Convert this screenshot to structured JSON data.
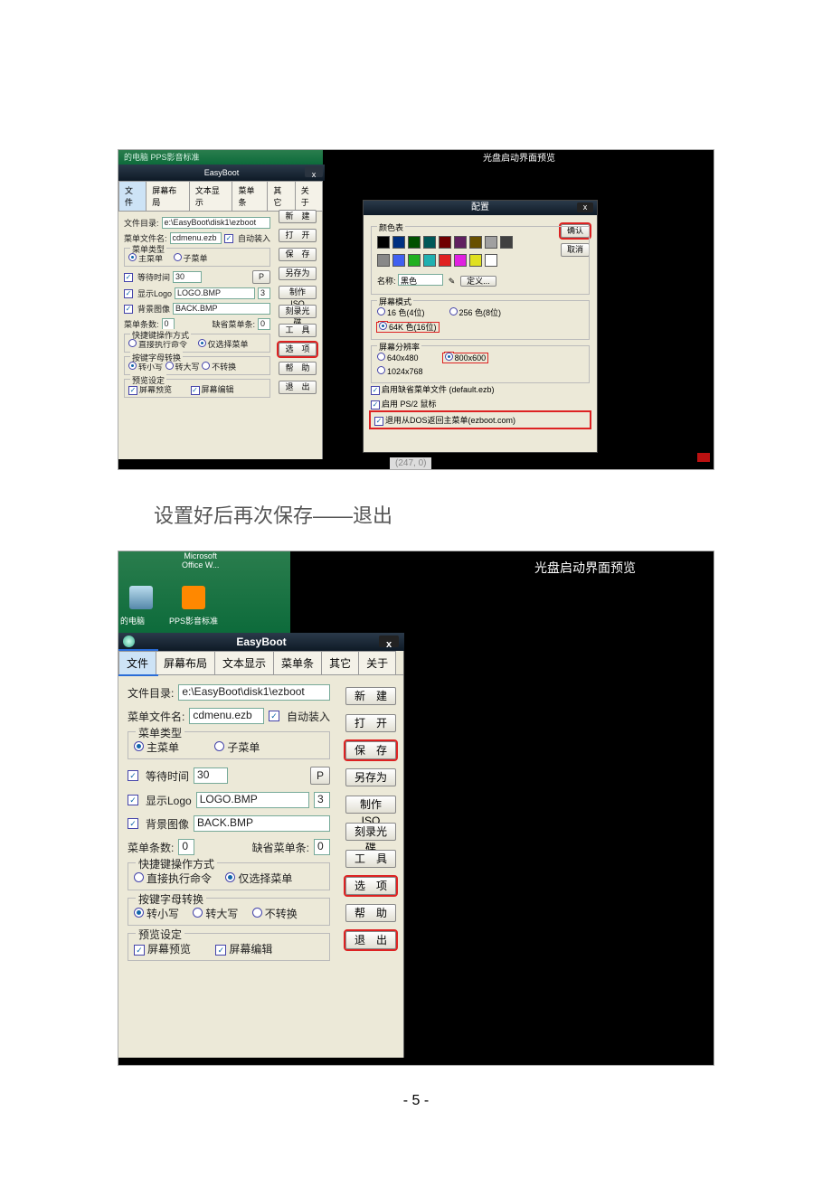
{
  "s1": {
    "desktop": "的电脑   PPS影音标准",
    "app_title": "EasyBoot",
    "close": "x",
    "tabs": [
      "文件",
      "屏幕布局",
      "文本显示",
      "菜单条",
      "其它",
      "关于"
    ],
    "rows": {
      "dir_lbl": "文件目录:",
      "dir_val": "e:\\EasyBoot\\disk1\\ezboot",
      "menu_lbl": "菜单文件名:",
      "menu_val": "cdmenu.ezb",
      "autoload": "自动装入",
      "type_leg": "菜单类型",
      "main": "主菜单",
      "sub": "子菜单",
      "wait_lbl": "等待时间",
      "wait_val": "30",
      "p": "P",
      "logo_lbl": "显示Logo",
      "logo_val": "LOGO.BMP",
      "logo_n": "3",
      "bg_lbl": "背景图像",
      "bg_val": "BACK.BMP",
      "count_lbl": "菜单条数:",
      "count_val": "0",
      "def_lbl": "缺省菜单条:",
      "def_val": "0",
      "hk_leg": "快捷键操作方式",
      "hk1": "直接执行命令",
      "hk2": "仅选择菜单",
      "case_leg": "按键字母转换",
      "c1": "转小写",
      "c2": "转大写",
      "c3": "不转换",
      "pv_leg": "预览设定",
      "pv1": "屏幕预览",
      "pv2": "屏幕编辑"
    },
    "rbtns": [
      "新　建",
      "打　开",
      "保　存",
      "另存为",
      "制作ISO",
      "刻录光碟",
      "工　具",
      "选　项",
      "帮　助",
      "退　出"
    ],
    "preview_title": "光盘启动界面预览",
    "coord": "(247, 0)",
    "cfg": {
      "title": "配置",
      "ok": "确认",
      "cancel": "取消",
      "color_leg": "颜色表",
      "name_lbl": "名称:",
      "name_val": "黑色",
      "def_btn": "定义...",
      "mode_leg": "屏幕模式",
      "m1": "16 色(4位)",
      "m2": "256 色(8位)",
      "m3": "64K 色(16位)",
      "res_leg": "屏幕分辨率",
      "r1": "640x480",
      "r2": "800x600",
      "r3": "1024x768",
      "chk1": "启用缺省菜单文件 (default.ezb)",
      "chk2": "启用 PS/2 鼠标",
      "chk3": "退用从DOS返回主菜单(ezboot.com)"
    },
    "swatches_top": [
      "#000",
      "#003080",
      "#005000",
      "#005858",
      "#700000",
      "#602060",
      "#685000",
      "#a0a0a0",
      "#404040"
    ],
    "swatches_bot": [
      "#888",
      "#4060f0",
      "#20b020",
      "#20b0b0",
      "#e02020",
      "#e020e0",
      "#e0e020",
      "#fff"
    ]
  },
  "caption": "设置好后再次保存——退出",
  "s2": {
    "desk": {
      "a": "Microsoft",
      "b": "Office W...",
      "c": "的电脑",
      "d": "PPS影音标准"
    },
    "app_title": "EasyBoot",
    "close": "x",
    "tabs": [
      "文件",
      "屏幕布局",
      "文本显示",
      "菜单条",
      "其它",
      "关于"
    ],
    "rows": {
      "dir_lbl": "文件目录:",
      "dir_val": "e:\\EasyBoot\\disk1\\ezboot",
      "menu_lbl": "菜单文件名:",
      "menu_val": "cdmenu.ezb",
      "autoload": "自动装入",
      "type_leg": "菜单类型",
      "main": "主菜单",
      "sub": "子菜单",
      "wait_lbl": "等待时间",
      "wait_val": "30",
      "p": "P",
      "logo_lbl": "显示Logo",
      "logo_val": "LOGO.BMP",
      "logo_n": "3",
      "bg_lbl": "背景图像",
      "bg_val": "BACK.BMP",
      "count_lbl": "菜单条数:",
      "count_val": "0",
      "def_lbl": "缺省菜单条:",
      "def_val": "0",
      "hk_leg": "快捷键操作方式",
      "hk1": "直接执行命令",
      "hk2": "仅选择菜单",
      "case_leg": "按键字母转换",
      "c1": "转小写",
      "c2": "转大写",
      "c3": "不转换",
      "pv_leg": "预览设定",
      "pv1": "屏幕预览",
      "pv2": "屏幕编辑"
    },
    "rbtns": [
      "新　建",
      "打　开",
      "保　存",
      "另存为",
      "制作ISO",
      "刻录光碟",
      "工　具",
      "选　项",
      "帮　助",
      "退　出"
    ],
    "preview_title": "光盘启动界面预览"
  },
  "page_num": "- 5 -"
}
